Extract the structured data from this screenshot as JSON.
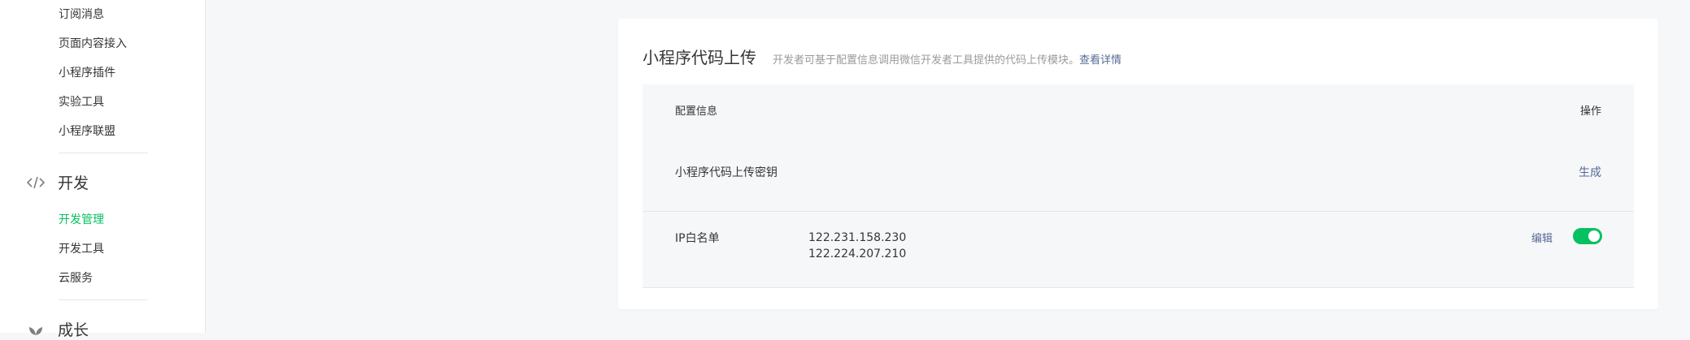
{
  "sidebar": {
    "items_top": [
      {
        "label": "订阅消息"
      },
      {
        "label": "页面内容接入"
      },
      {
        "label": "小程序插件"
      },
      {
        "label": "实验工具"
      },
      {
        "label": "小程序联盟"
      }
    ],
    "dev_section": {
      "title": "开发",
      "icon": "code-icon",
      "items": [
        {
          "label": "开发管理",
          "active": true
        },
        {
          "label": "开发工具"
        },
        {
          "label": "云服务"
        }
      ]
    },
    "growth_section": {
      "title": "成长",
      "icon": "sprout-icon"
    }
  },
  "card": {
    "title": "小程序代码上传",
    "description": "开发者可基于配置信息调用微信开发者工具提供的代码上传模块。",
    "link": "查看详情",
    "table": {
      "headers": {
        "config": "配置信息",
        "action": "操作"
      },
      "rows": [
        {
          "name": "小程序代码上传密钥",
          "action": "生成"
        },
        {
          "name": "IP白名单",
          "values": [
            "122.231.158.230",
            "122.224.207.210"
          ],
          "action": "编辑",
          "toggle_on": true
        }
      ]
    }
  },
  "colors": {
    "accent": "#07c160",
    "link": "#576b95",
    "background": "#f6f7f9"
  }
}
